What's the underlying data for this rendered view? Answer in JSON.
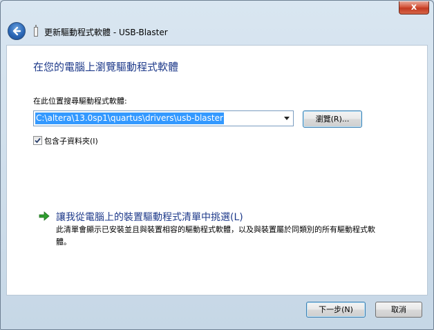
{
  "window": {
    "title": "更新驅動程式軟體 - USB-Blaster",
    "close_glyph": "x"
  },
  "content": {
    "heading": "在您的電腦上瀏覽驅動程式軟體",
    "search_label": "在此位置搜尋驅動程式軟體:",
    "path_value": "C:\\altera\\13.0sp1\\quartus\\drivers\\usb-blaster",
    "browse_label": "瀏覽(R)...",
    "include_subfolders_label": "包含子資料夾(I)",
    "include_subfolders_checked": true,
    "pick_title": "讓我從電腦上的裝置驅動程式清單中挑選(L)",
    "pick_desc": "此清單會顯示已安裝並且與裝置相容的驅動程式軟體，以及與裝置屬於同類別的所有驅動程式軟體。"
  },
  "footer": {
    "next_label": "下一步(N)",
    "cancel_label": "取消"
  },
  "icons": {
    "back": "back-arrow-icon",
    "device": "usb-device-icon",
    "link_arrow": "green-arrow-icon",
    "checkmark": "checkmark-icon",
    "dropdown": "chevron-down-icon"
  },
  "colors": {
    "heading": "#1e3a8a",
    "selection": "#3399ff",
    "close": "#c23a21",
    "link_arrow": "#2e9e2e"
  }
}
